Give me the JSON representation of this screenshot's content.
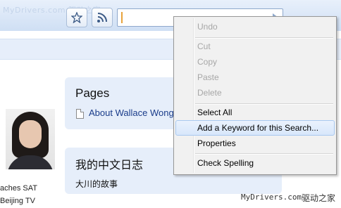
{
  "toolbar": {
    "watermark_text": "MyDrivers.com 驱动之家",
    "bookmark_icon": "star-icon",
    "feed_icon": "rss-icon",
    "search_value": ""
  },
  "profile": {
    "caption_line1": "aches SAT",
    "caption_line2": "Beijing TV"
  },
  "cards": {
    "pages_title": "Pages",
    "pages_link": "About Wallace Wong",
    "blog_title": "我的中文日志",
    "blog_item": "大川的故事"
  },
  "context_menu": {
    "items": [
      {
        "label": "Undo",
        "enabled": false
      },
      {
        "label": "Cut",
        "enabled": false
      },
      {
        "label": "Copy",
        "enabled": false
      },
      {
        "label": "Paste",
        "enabled": false
      },
      {
        "label": "Delete",
        "enabled": false
      },
      {
        "label": "Select All",
        "enabled": true
      },
      {
        "label": "Add a Keyword for this Search...",
        "enabled": true,
        "highlighted": true
      },
      {
        "label": "Properties",
        "enabled": true
      },
      {
        "label": "Check Spelling",
        "enabled": true
      }
    ]
  },
  "footer": {
    "site": "MyDrivers.com",
    "site_cn": "驱动之家"
  }
}
